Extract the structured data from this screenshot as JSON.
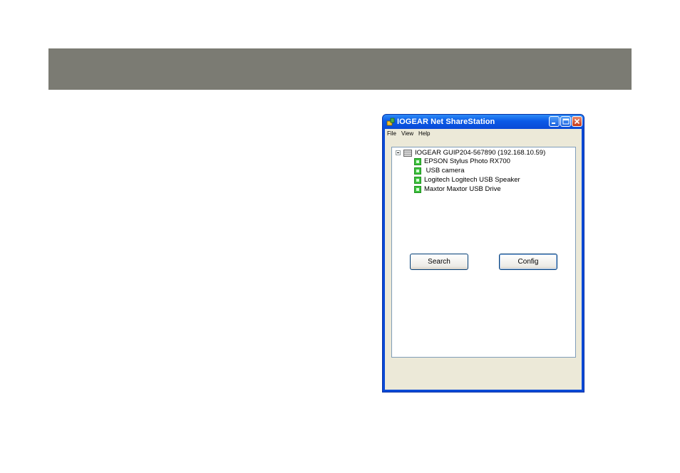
{
  "window": {
    "title": "IOGEAR Net ShareStation",
    "colors": {
      "titlebar": "#0a4ad6",
      "client": "#ece9d8",
      "header_band": "#7b7b73"
    }
  },
  "menu": [
    "File",
    "View",
    "Help"
  ],
  "tree": {
    "root": "IOGEAR GUIP204-567890 (192.168.10.59)",
    "children": [
      "EPSON Stylus Photo RX700",
      " USB camera",
      "Logitech Logitech USB Speaker",
      "Maxtor Maxtor USB Drive"
    ]
  },
  "buttons": {
    "search": "Search",
    "config": "Config"
  },
  "icons": {
    "app": "app-icon",
    "server": "server-icon",
    "device": "usb-device-icon"
  }
}
